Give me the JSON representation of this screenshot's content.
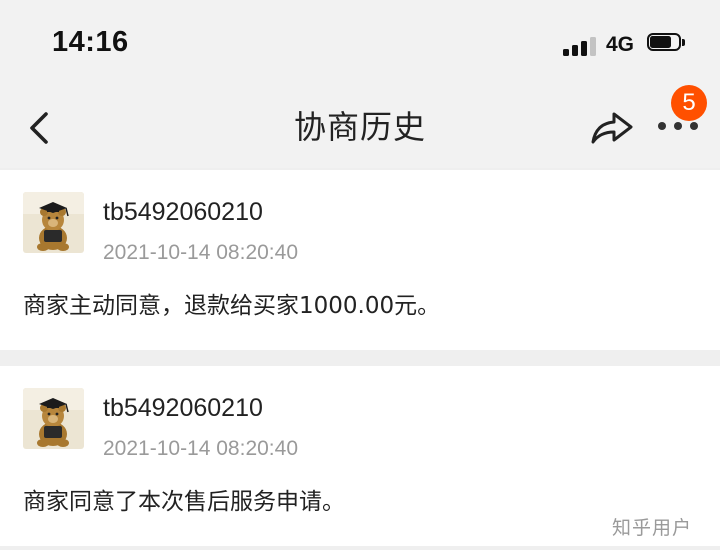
{
  "status_bar": {
    "time": "14:16",
    "network": "4G",
    "signal_bars_active": 3,
    "signal_bars_total": 4,
    "battery_level": 0.75
  },
  "nav": {
    "title": "协商历史",
    "badge_count": "5",
    "icons": [
      "chevron-left-icon",
      "share-icon",
      "more-icon"
    ]
  },
  "records": [
    {
      "username": "tb5492060210",
      "time": "2021-10-14 08:20:40",
      "message": "商家主动同意，退款给买家1000.00元。"
    },
    {
      "username": "tb5492060210",
      "time": "2021-10-14 08:20:40",
      "message": "商家同意了本次售后服务申请。"
    }
  ],
  "watermark": "知乎用户",
  "colors": {
    "badge": "#ff5000",
    "background": "#efefef",
    "card": "#ffffff",
    "secondary_text": "#9a9a9a"
  }
}
